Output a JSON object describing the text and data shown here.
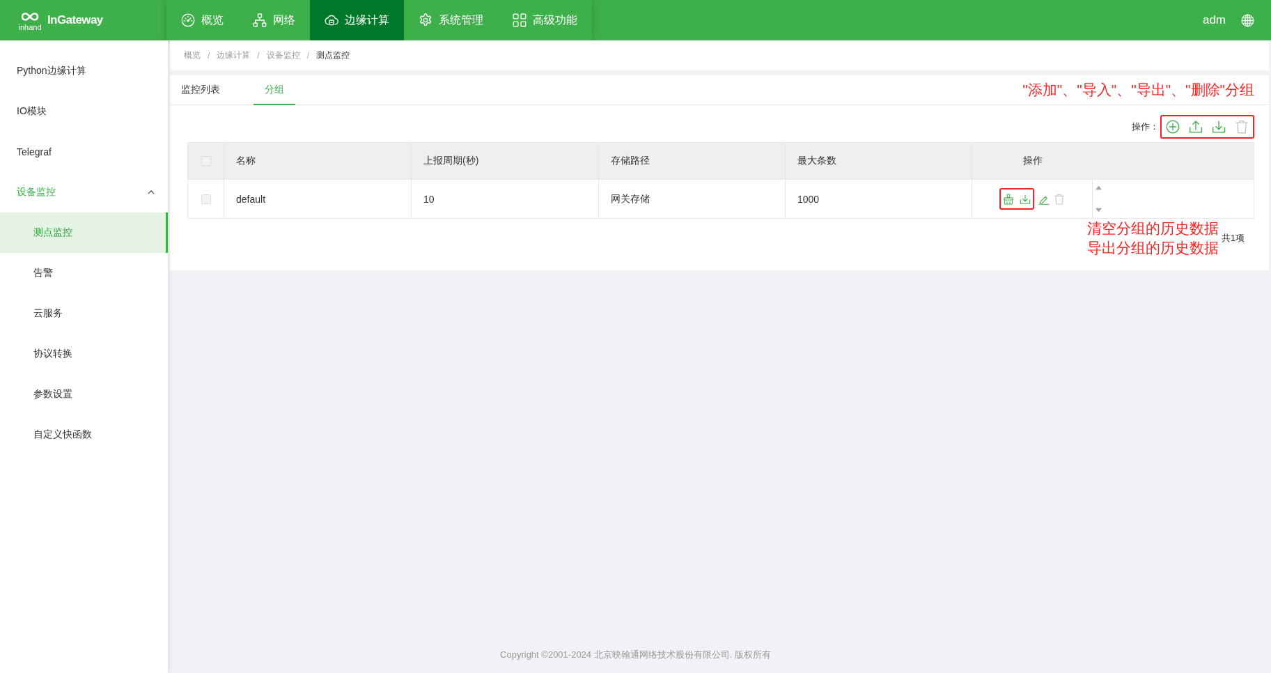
{
  "header": {
    "logo": {
      "mark": "inhand",
      "name": "InGateway"
    },
    "nav": [
      {
        "label": "概览",
        "selected": false
      },
      {
        "label": "网络",
        "selected": false
      },
      {
        "label": "边缘计算",
        "selected": true
      },
      {
        "label": "系统管理",
        "selected": false
      },
      {
        "label": "高级功能",
        "selected": false
      }
    ],
    "user": "adm"
  },
  "sidebar": {
    "items": [
      {
        "label": "Python边缘计算",
        "selected": false
      },
      {
        "label": "IO模块",
        "selected": false
      },
      {
        "label": "Telegraf",
        "selected": false
      },
      {
        "label": "设备监控",
        "selected": false,
        "expanded": true,
        "children": [
          {
            "label": "测点监控",
            "selected": true
          },
          {
            "label": "告警",
            "selected": false
          },
          {
            "label": "云服务",
            "selected": false
          },
          {
            "label": "协议转换",
            "selected": false
          },
          {
            "label": "参数设置",
            "selected": false
          },
          {
            "label": "自定义快函数",
            "selected": false
          }
        ]
      }
    ]
  },
  "breadcrumb": [
    "概览",
    "/",
    "边缘计算",
    "/",
    "设备监控",
    "/",
    "测点监控"
  ],
  "tabs": [
    {
      "label": "监控列表",
      "selected": false
    },
    {
      "label": "分组",
      "selected": true
    }
  ],
  "annotations": {
    "toolbar_actions": "\"添加\"、\"导入\"、\"导出\"、\"删除\"分组",
    "row_actions": [
      "清空分组的历史数据",
      "导出分组的历史数据"
    ]
  },
  "toolbar": {
    "label": "操作：",
    "actions": [
      {
        "kind": "add",
        "disabled": false,
        "highlighted": true
      },
      {
        "kind": "import",
        "disabled": false,
        "highlighted": true
      },
      {
        "kind": "export",
        "disabled": false,
        "highlighted": true
      },
      {
        "kind": "delete",
        "disabled": true,
        "highlighted": true
      }
    ]
  },
  "table": {
    "select_all": {
      "checked": false
    },
    "columns": [
      "名称",
      "上报周期(秒)",
      "存储路径",
      "最大条数",
      "操作"
    ],
    "rows": [
      {
        "selected": false,
        "cells": [
          "default",
          "10",
          "网关存储",
          "1000"
        ],
        "actions": [
          {
            "kind": "clear",
            "disabled": false,
            "highlighted": true
          },
          {
            "kind": "export",
            "disabled": false,
            "highlighted": true
          },
          {
            "kind": "edit",
            "disabled": false,
            "highlighted": false
          },
          {
            "kind": "delete",
            "disabled": true,
            "highlighted": false
          }
        ]
      }
    ]
  },
  "pagination": {
    "total": "共1项"
  },
  "footer": "Copyright ©2001-2024 北京映翰通网络技术股份有限公司. 版权所有"
}
